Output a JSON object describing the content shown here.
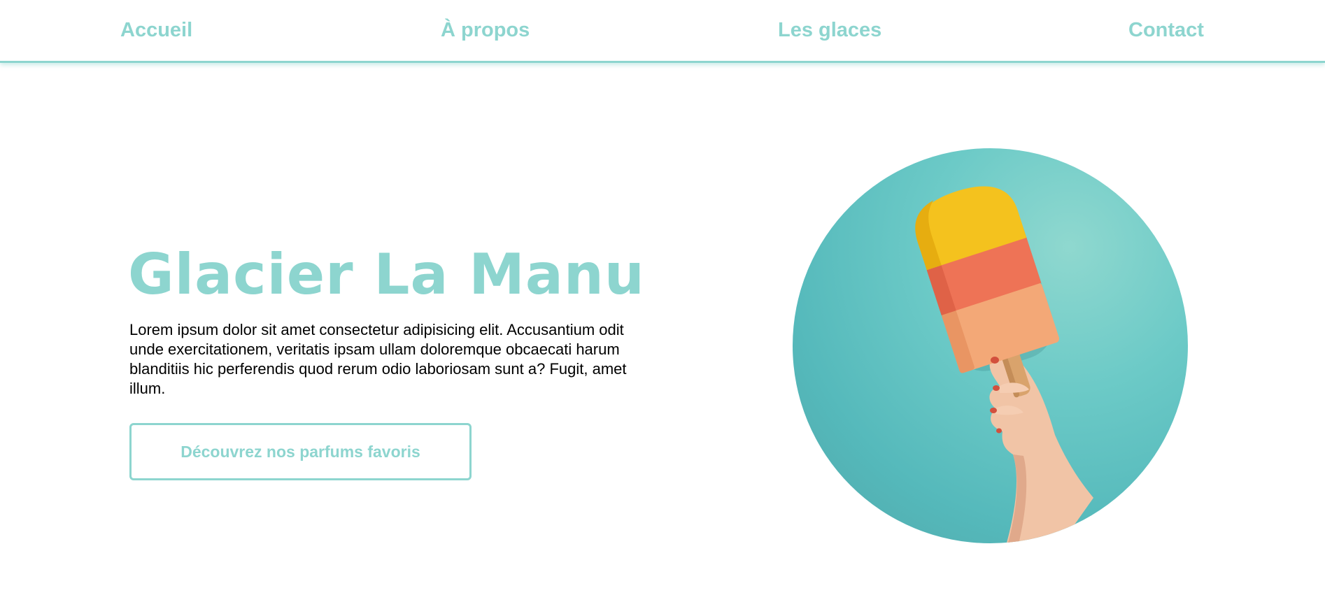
{
  "nav": {
    "items": [
      {
        "label": "Accueil"
      },
      {
        "label": "À propos"
      },
      {
        "label": "Les glaces"
      },
      {
        "label": "Contact"
      }
    ]
  },
  "hero": {
    "title": "Glacier La Manu",
    "description": "Lorem ipsum dolor sit amet consectetur adipisicing elit. Accusantium odit unde exercitationem, veritatis ipsam ullam doloremque obcaecati harum blanditiis hic perferendis quod rerum odio laboriosam sunt a? Fugit, amet illum.",
    "button_label": "Découvrez nos parfums favoris",
    "image": "popsicle-hand-photo"
  },
  "colors": {
    "accent": "#8dd5cf",
    "text": "#000000",
    "background": "#ffffff"
  }
}
